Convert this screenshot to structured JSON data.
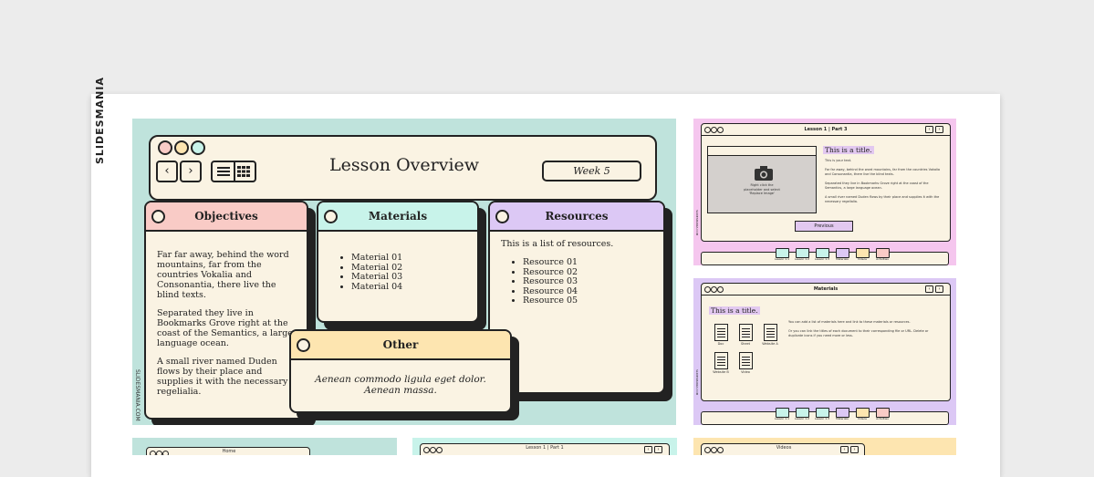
{
  "brand": "SLIDESMANIA",
  "main": {
    "title": "Lesson Overview",
    "week": "Week 5",
    "colors": {
      "bg": "#bfe3dc",
      "objectives": "#f9cbc6",
      "materials": "#c8f3ea",
      "resources": "#dcc8f5",
      "other": "#fde5b0",
      "window": "#faf3e3",
      "dot1": "#f9cbc6",
      "dot2": "#fde5b0",
      "dot3": "#c8f3ea"
    },
    "nav_icons": [
      "chevron-left-icon",
      "chevron-right-icon",
      "list-view-icon",
      "grid-view-icon"
    ],
    "objectives": {
      "heading": "Objectives",
      "p1": "Far far away, behind the word mountains, far from the countries Vokalia and Consonantia, there live the blind texts.",
      "p2": "Separated they live in Bookmarks Grove right at the coast of the Semantics, a large language ocean.",
      "p3": "A small river named Duden flows by their place and supplies it with the necessary regelialia."
    },
    "materials": {
      "heading": "Materials",
      "items": [
        "Material 01",
        "Material 02",
        "Material 03",
        "Material 04"
      ]
    },
    "resources": {
      "heading": "Resources",
      "intro": "This is a list of resources.",
      "items": [
        "Resource 01",
        "Resource 02",
        "Resource 03",
        "Resource 04",
        "Resource 05"
      ]
    },
    "other": {
      "heading": "Other",
      "text": "Aenean commodo ligula eget dolor. Aenean massa."
    },
    "side_url": "SLIDESMANIA.COM"
  },
  "thumb1": {
    "bar": "Lesson 1 | Part 3",
    "title": "This is a title.",
    "t1": "This is your text.",
    "t2": "Far far away, behind the word mountains, far from the countries Vokalia and Consonantia, there live the blind texts.",
    "t3": "Separated they live in Bookmarks Grove right at the coast of the Semantics, a large language ocean.",
    "t4": "A small river named Duden flows by their place and supplies it with the necessary regelialia.",
    "img_text": "Right click the placeholder and select 'Replace Image'",
    "prev": "Previous",
    "side_url": "SLIDESMANIA.COM",
    "tabs": [
      "Lesson 1.1",
      "Lesson 1.2",
      "Lesson 1.3",
      "Materials",
      "Videos",
      "Activities"
    ],
    "bg": "#f5c6ee"
  },
  "thumb2": {
    "bar": "Materials",
    "title": "This is a title.",
    "t1": "You can add a list of materials here and link to these materials or resources.",
    "t2": "Or you can link the titles of each document to their corresponding file or URL. Delete or duplicate icons if you need more or less.",
    "docs": [
      "Doc",
      "Sheet",
      "Website A",
      "Website B",
      "Video"
    ],
    "side_url": "SLIDESMANIA.COM",
    "tabs": [
      "Lesson 1.1",
      "Lesson 1.2",
      "Lesson 1.3",
      "Materials",
      "Videos",
      "Activities"
    ],
    "bg": "#dcc8f5"
  },
  "bottom": {
    "b1": "Home",
    "b2": "Lesson 1 | Part 1",
    "b3": "Videos"
  }
}
